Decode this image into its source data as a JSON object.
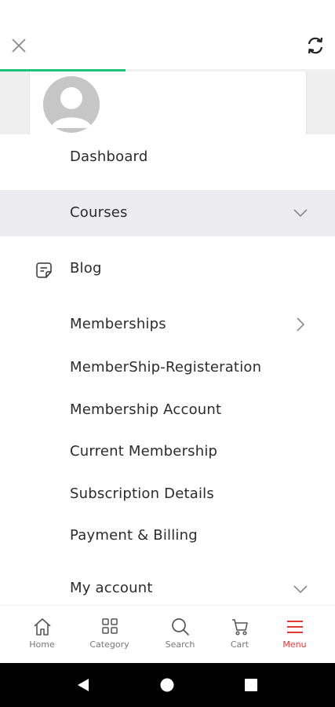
{
  "header": {
    "close_icon": "close-icon",
    "refresh_icon": "refresh-icon",
    "progress": 0.375,
    "accent": "#1ec37a"
  },
  "profile": {
    "avatar_icon": "avatar-placeholder-icon"
  },
  "menu": {
    "items": [
      {
        "label": "Dashboard"
      },
      {
        "label": "Courses",
        "chevron": "chevron-down-icon",
        "active": true
      },
      {
        "label": "Blog",
        "icon": "blog-note-icon"
      },
      {
        "label": "Memberships",
        "chevron": "chevron-right-icon"
      },
      {
        "label": "MemberShip-Registeration"
      },
      {
        "label": "Membership Account"
      },
      {
        "label": "Current Membership"
      },
      {
        "label": "Subscription Details"
      },
      {
        "label": "Payment & Billing"
      },
      {
        "label": "My account",
        "chevron": "chevron-down-icon"
      }
    ]
  },
  "bottom_nav": {
    "items": [
      {
        "label": "Home",
        "icon": "home-icon"
      },
      {
        "label": "Category",
        "icon": "grid-icon"
      },
      {
        "label": "Search",
        "icon": "search-icon"
      },
      {
        "label": "Cart",
        "icon": "cart-icon"
      },
      {
        "label": "Menu",
        "icon": "menu-icon",
        "active": true
      }
    ],
    "active_color": "#e53935"
  },
  "system_bar": {
    "buttons": [
      "back-icon",
      "home-circle-icon",
      "recents-icon"
    ]
  }
}
